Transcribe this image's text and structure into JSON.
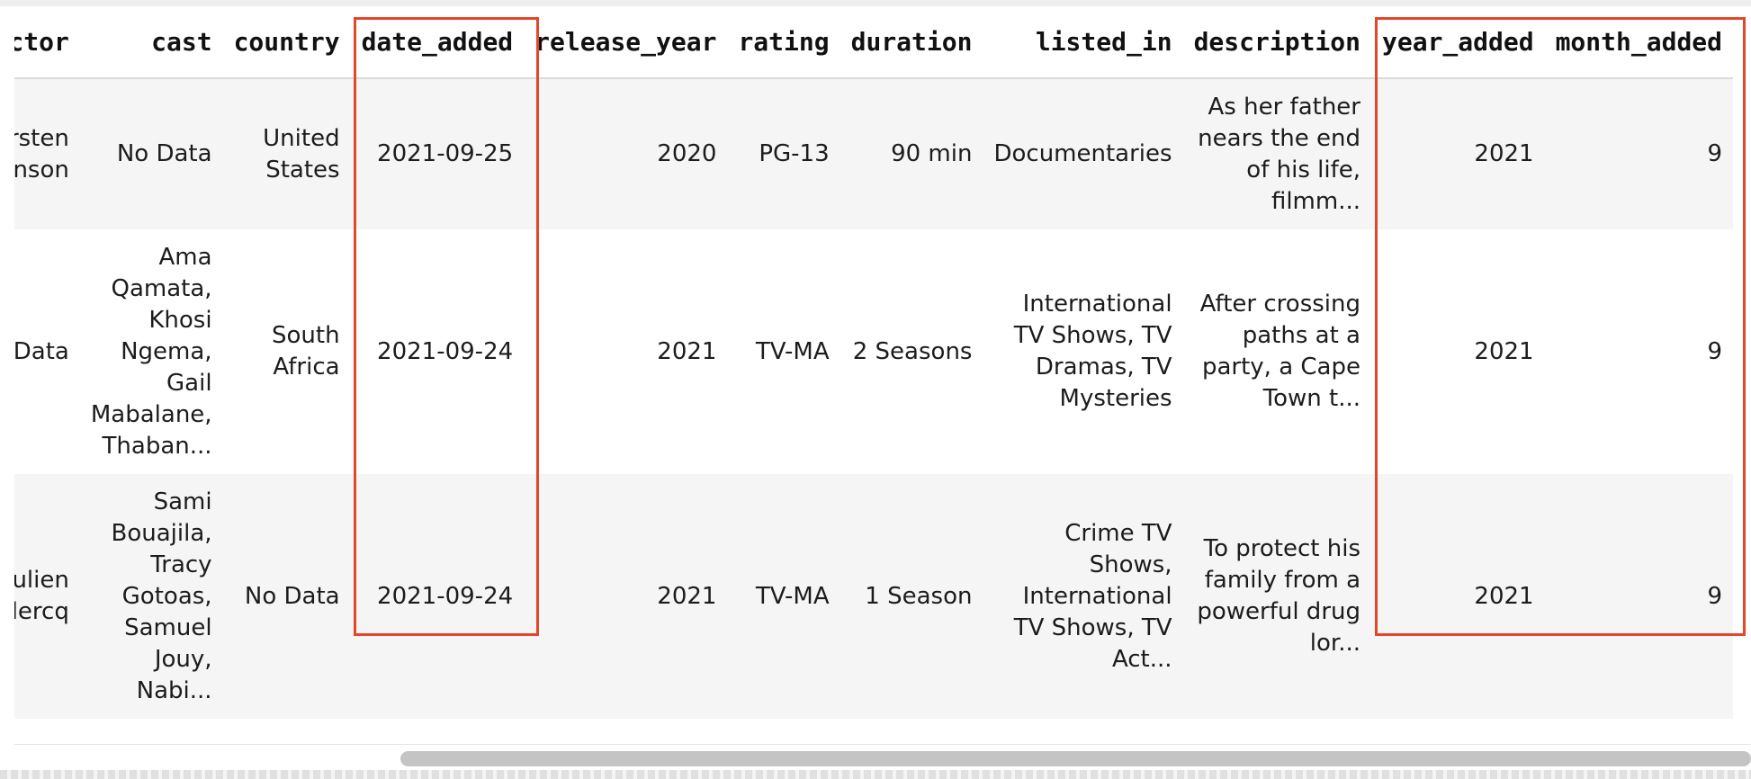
{
  "table": {
    "columns": [
      {
        "key": "director",
        "label": "director"
      },
      {
        "key": "cast",
        "label": "cast"
      },
      {
        "key": "country",
        "label": "country"
      },
      {
        "key": "date_added",
        "label": "date_added"
      },
      {
        "key": "release_year",
        "label": "release_year"
      },
      {
        "key": "rating",
        "label": "rating"
      },
      {
        "key": "duration",
        "label": "duration"
      },
      {
        "key": "listed_in",
        "label": "listed_in"
      },
      {
        "key": "description",
        "label": "description"
      },
      {
        "key": "year_added",
        "label": "year_added"
      },
      {
        "key": "month_added",
        "label": "month_added"
      }
    ],
    "rows": [
      {
        "director": "Kirsten\nJohnson",
        "cast": "No Data",
        "country": "United\nStates",
        "date_added": "2021-09-25",
        "release_year": "2020",
        "rating": "PG-13",
        "duration": "90 min",
        "listed_in": "Documentaries",
        "description": "As her father\nnears the end\nof his life,\nfilmm...",
        "year_added": "2021",
        "month_added": "9"
      },
      {
        "director": "No Data",
        "cast": "Ama\nQamata,\nKhosi\nNgema,\nGail\nMabalane,\nThaban...",
        "country": "South\nAfrica",
        "date_added": "2021-09-24",
        "release_year": "2021",
        "rating": "TV-MA",
        "duration": "2 Seasons",
        "listed_in": "International\nTV Shows, TV\nDramas, TV\nMysteries",
        "description": "After crossing\npaths at a\nparty, a Cape\nTown t...",
        "year_added": "2021",
        "month_added": "9"
      },
      {
        "director": "Julien\nLeclercq",
        "cast": "Sami\nBouajila,\nTracy\nGotoas,\nSamuel\nJouy,\nNabi...",
        "country": "No Data",
        "date_added": "2021-09-24",
        "release_year": "2021",
        "rating": "TV-MA",
        "duration": "1 Season",
        "listed_in": "Crime TV\nShows,\nInternational\nTV Shows, TV\nAct...",
        "description": "To protect his\nfamily from a\npowerful drug\nlor...",
        "year_added": "2021",
        "month_added": "9"
      }
    ]
  },
  "highlights": {
    "color": "#e2472a",
    "columns": [
      "date_added",
      "year_added",
      "month_added"
    ]
  },
  "scrollbar": {
    "horizontal_position_fraction": 0.23
  }
}
